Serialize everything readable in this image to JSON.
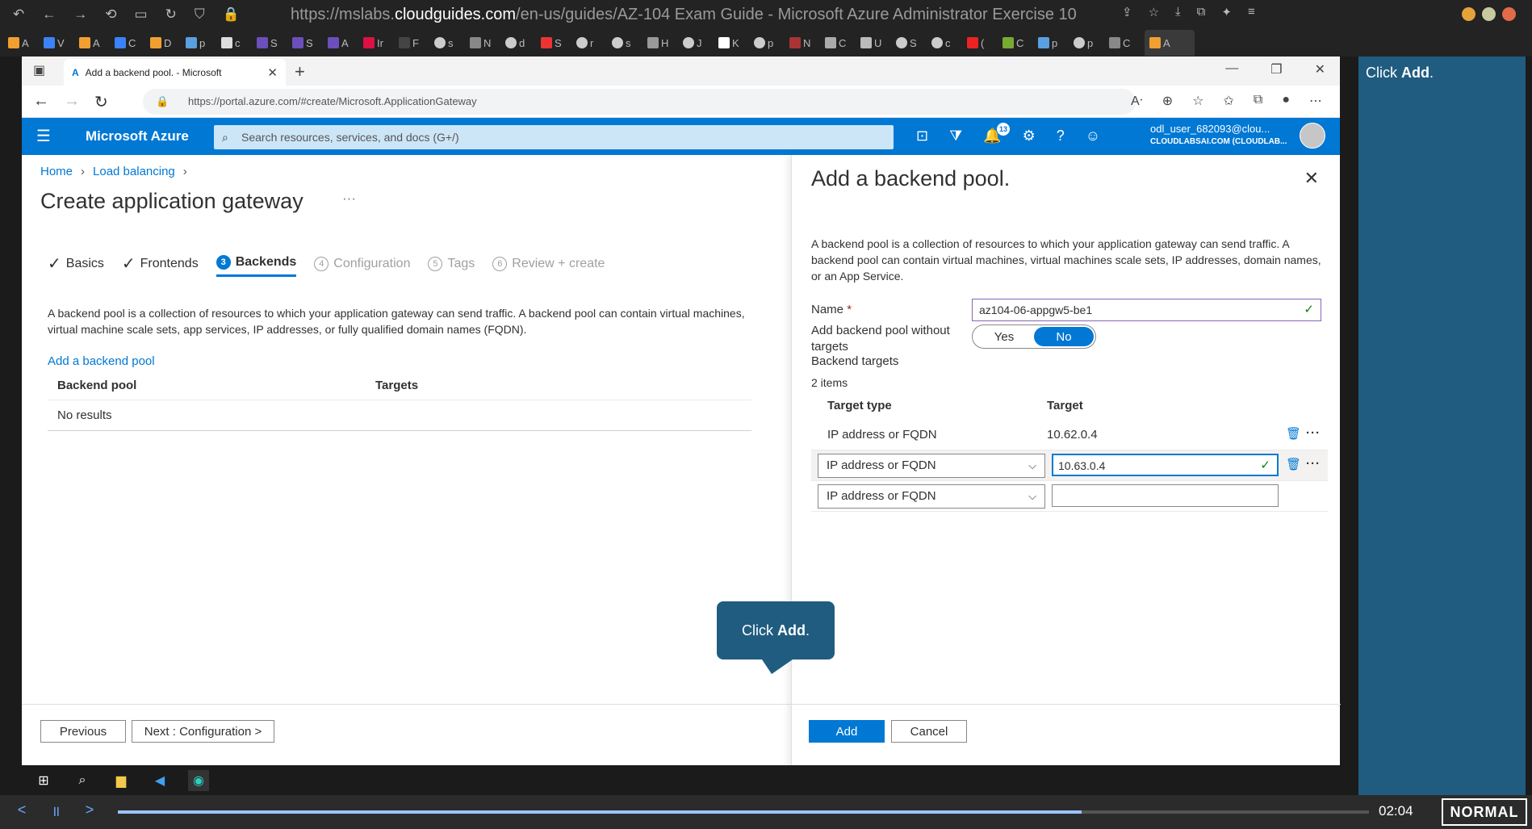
{
  "outer_browser": {
    "url_prefix": "https://mslabs.",
    "url_domain": "cloudguides.com",
    "url_rest": "/en-us/guides/AZ-104 Exam Guide - Microsoft Azure Administrator Exercise 10"
  },
  "bookmarks": [
    "A",
    "V",
    "A",
    "C",
    "D",
    "p",
    "c",
    "S",
    "S",
    "A",
    "Ir",
    "F",
    "s",
    "N",
    "d",
    "S",
    "r",
    "s",
    "H",
    "J",
    "K",
    "p",
    "N",
    "C",
    "U",
    "S",
    "c",
    "(",
    "C",
    "p",
    "p",
    "C",
    "A"
  ],
  "edge": {
    "tab_title": "Add a backend pool. - Microsoft",
    "url": "https://portal.azure.com/#create/Microsoft.ApplicationGateway"
  },
  "azure": {
    "brand": "Microsoft Azure",
    "search_placeholder": "Search resources, services, and docs (G+/)",
    "notifications_count": "13",
    "user_name": "odl_user_682093@clou...",
    "user_tenant": "CLOUDLABSAI.COM (CLOUDLAB..."
  },
  "left": {
    "breadcrumb": [
      "Home",
      "Load balancing"
    ],
    "title": "Create application gateway",
    "steps": [
      {
        "label": "Basics",
        "mark": "✓"
      },
      {
        "label": "Frontends",
        "mark": "✓"
      },
      {
        "label": "Backends",
        "mark": "3"
      },
      {
        "label": "Configuration",
        "mark": "4"
      },
      {
        "label": "Tags",
        "mark": "5"
      },
      {
        "label": "Review + create",
        "mark": "6"
      }
    ],
    "description": "A backend pool is a collection of resources to which your application gateway can send traffic. A backend pool can contain virtual machines, virtual machine scale sets, app services, IP addresses, or fully qualified domain names (FQDN).",
    "add_link": "Add a backend pool",
    "table_headers": [
      "Backend pool",
      "Targets"
    ],
    "empty_text": "No results",
    "prev_button": "Previous",
    "next_button": "Next : Configuration >"
  },
  "panel": {
    "title": "Add a backend pool.",
    "description": "A backend pool is a collection of resources to which your application gateway can send traffic. A backend pool can contain virtual machines, virtual machines scale sets, IP addresses, domain names, or an App Service.",
    "name_label": "Name",
    "name_value": "az104-06-appgw5-be1",
    "without_targets_label": "Add backend pool without targets",
    "toggle_yes": "Yes",
    "toggle_no": "No",
    "backend_targets_label": "Backend targets",
    "items_count": "2 items",
    "col_type": "Target type",
    "col_target": "Target",
    "rows": [
      {
        "type": "IP address or FQDN",
        "target": "10.62.0.4"
      },
      {
        "type": "IP address or FQDN",
        "target": "10.63.0.4"
      },
      {
        "type": "IP address or FQDN",
        "target": ""
      }
    ],
    "add_button": "Add",
    "cancel_button": "Cancel"
  },
  "callout": {
    "prefix": "Click ",
    "bold": "Add",
    "suffix": "."
  },
  "sidebar_note": {
    "prefix": "Click ",
    "bold": "Add",
    "suffix": "."
  },
  "player": {
    "time": "02:04",
    "mode": "NORMAL",
    "progress": 0.77
  }
}
